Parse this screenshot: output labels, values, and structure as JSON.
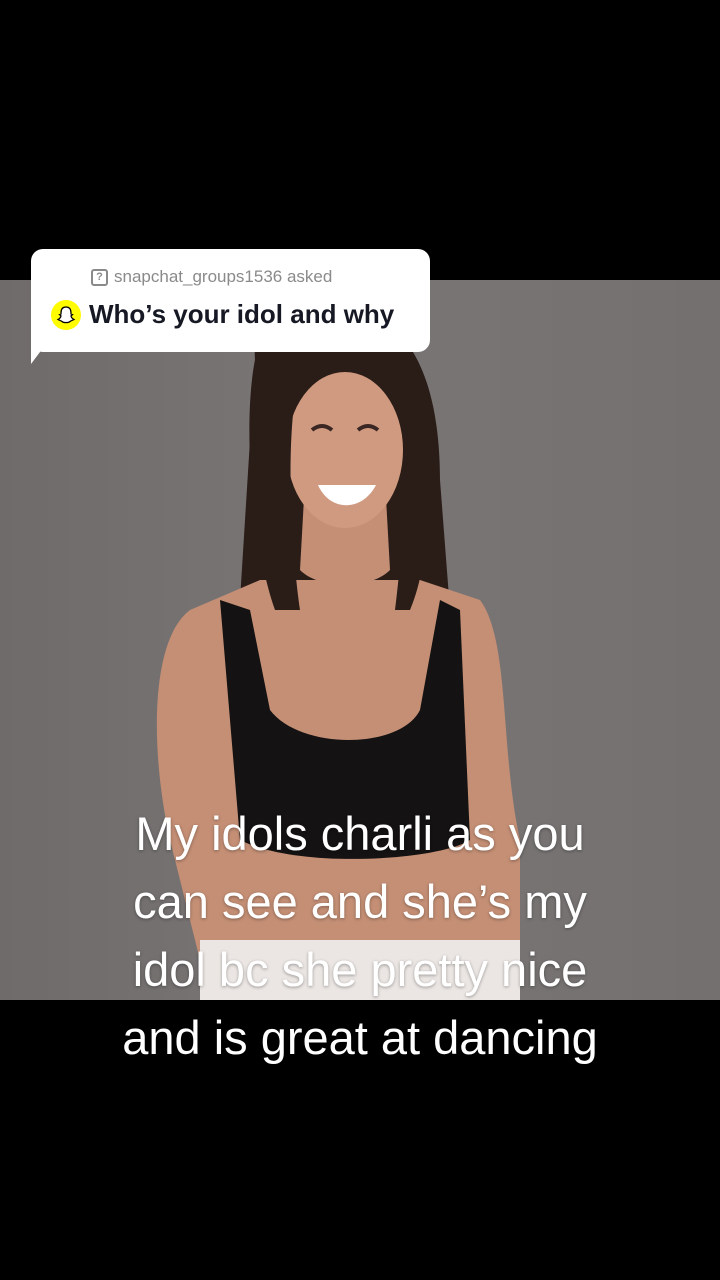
{
  "question_sticker": {
    "asker_text": "snapchat_groups1536 asked",
    "question_text": "Who’s your idol and why",
    "asker_icon": "question-box-icon",
    "question_icon": "snapchat-ghost-icon"
  },
  "caption": {
    "lines": [
      "My idols charli as you",
      "can see and she’s my",
      "idol bc she pretty nice",
      "and is great at dancing"
    ]
  },
  "colors": {
    "background": "#000000",
    "sticker": "#ffffff",
    "snapchat_yellow": "#fffc00",
    "caption_text": "#ffffff"
  }
}
